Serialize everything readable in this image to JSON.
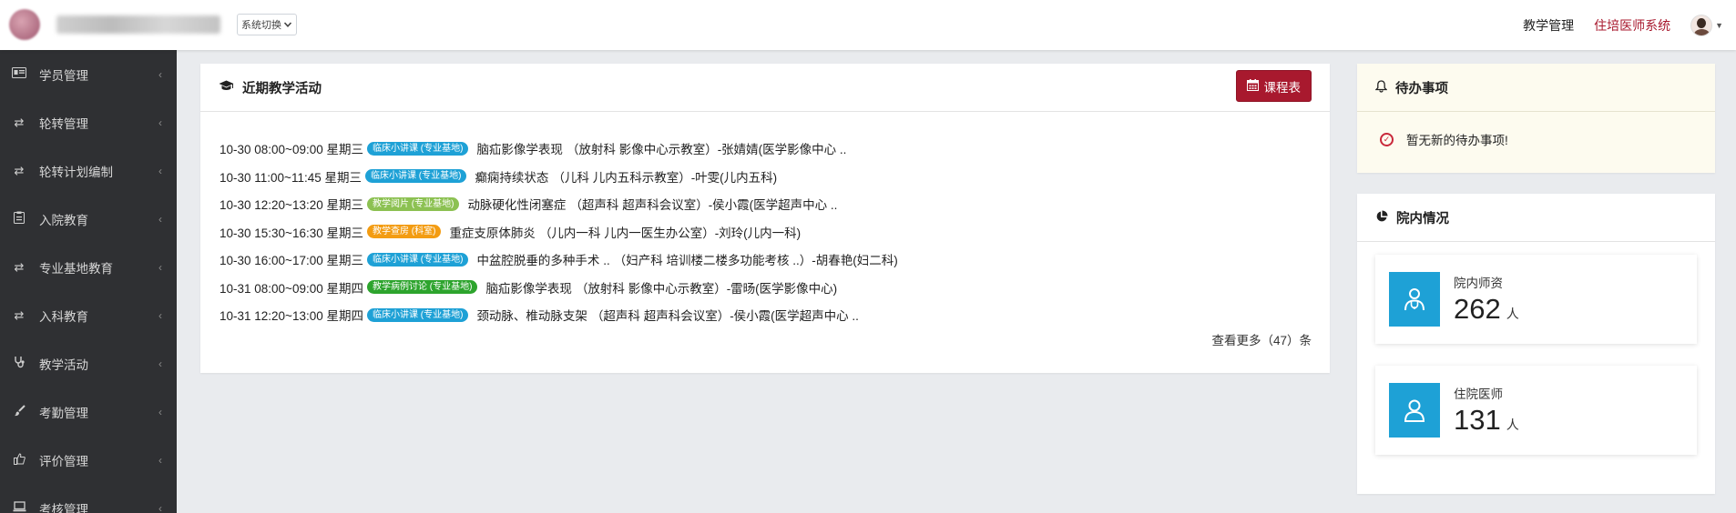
{
  "header": {
    "system_switch": "系统切换",
    "links": [
      "教学管理",
      "住培医师系统"
    ]
  },
  "sidebar": {
    "items": [
      {
        "label": "学员管理",
        "icon": "id-card-icon"
      },
      {
        "label": "轮转管理",
        "icon": "retweet-icon"
      },
      {
        "label": "轮转计划编制",
        "icon": "retweet-icon"
      },
      {
        "label": "入院教育",
        "icon": "clipboard-icon"
      },
      {
        "label": "专业基地教育",
        "icon": "retweet-icon"
      },
      {
        "label": "入科教育",
        "icon": "retweet-icon"
      },
      {
        "label": "教学活动",
        "icon": "stethoscope-icon"
      },
      {
        "label": "考勤管理",
        "icon": "brush-icon"
      },
      {
        "label": "评价管理",
        "icon": "thumbs-up-icon"
      },
      {
        "label": "考核管理",
        "icon": "laptop-icon"
      }
    ]
  },
  "activity": {
    "title": "近期教学活动",
    "schedule_button": "课程表",
    "rows": [
      {
        "time": "10-30 08:00~09:00 星期三",
        "badge": "临床小讲课 (专业基地)",
        "badge_color": "#1ea1d6",
        "title": "脑疝影像学表现",
        "detail": "（放射科  影像中心示教室）-张婧婧(医学影像中心 .."
      },
      {
        "time": "10-30 11:00~11:45 星期三",
        "badge": "临床小讲课 (专业基地)",
        "badge_color": "#1ea1d6",
        "title": "癫痫持续状态",
        "detail": "（儿科  儿内五科示教室）-叶雯(儿内五科)"
      },
      {
        "time": "10-30 12:20~13:20 星期三",
        "badge": "教学阅片 (专业基地)",
        "badge_color": "#8cc152",
        "title": "动脉硬化性闭塞症",
        "detail": "（超声科  超声科会议室）-侯小霞(医学超声中心 .."
      },
      {
        "time": "10-30 15:30~16:30 星期三",
        "badge": "教学查房 (科室)",
        "badge_color": "#f39c12",
        "title": "重症支原体肺炎",
        "detail": "（儿内一科  儿内一医生办公室）-刘玲(儿内一科)"
      },
      {
        "time": "10-30 16:00~17:00 星期三",
        "badge": "临床小讲课 (专业基地)",
        "badge_color": "#1ea1d6",
        "title": "中盆腔脱垂的多种手术 ..",
        "detail": "（妇产科  培训楼二楼多功能考核 ..）-胡春艳(妇二科)"
      },
      {
        "time": "10-31 08:00~09:00 星期四",
        "badge": "教学病例讨论 (专业基地)",
        "badge_color": "#2da42d",
        "title": "脑疝影像学表现",
        "detail": "（放射科  影像中心示教室）-雷旸(医学影像中心)"
      },
      {
        "time": "10-31 12:20~13:00 星期四",
        "badge": "临床小讲课 (专业基地)",
        "badge_color": "#1ea1d6",
        "title": "颈动脉、椎动脉支架",
        "detail": "（超声科  超声科会议室）-侯小霞(医学超声中心 .."
      }
    ],
    "more": "查看更多（47）条"
  },
  "todo": {
    "title": "待办事项",
    "empty_text": "暂无新的待办事项!"
  },
  "hospital": {
    "title": "院内情况",
    "stats": [
      {
        "label": "院内师资",
        "value": "262",
        "unit": "人",
        "icon": "doctor-icon"
      },
      {
        "label": "住院医师",
        "value": "131",
        "unit": "人",
        "icon": "user-icon"
      }
    ]
  },
  "colors": {
    "brand_red": "#a8192e",
    "sidebar_bg": "#2f3033",
    "stat_blue": "#1ea1d6"
  }
}
